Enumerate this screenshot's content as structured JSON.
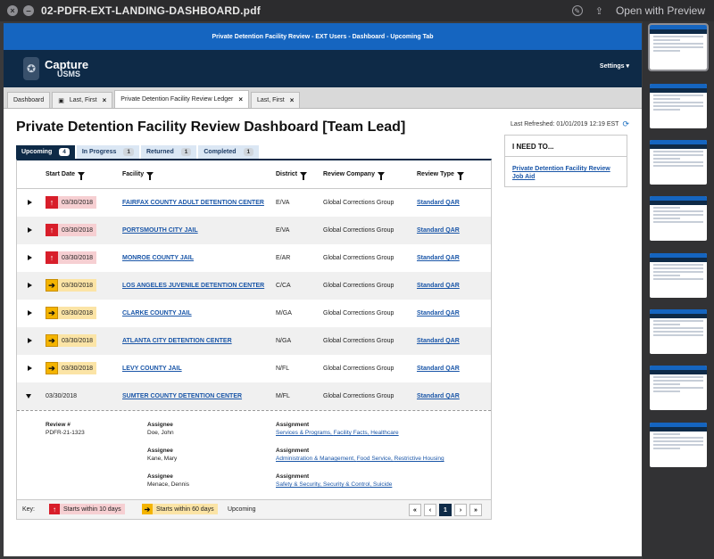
{
  "window": {
    "title": "02-PDFR-EXT-LANDING-DASHBOARD.pdf",
    "open_with": "Open with Preview"
  },
  "banner": "Private Detention Facility Review - EXT Users - Dashboard - Upcoming Tab",
  "header": {
    "logo_text": "Capture",
    "logo_sub": "USMS",
    "settings_label": "Settings ▾"
  },
  "page_tabs": [
    {
      "label": "Dashboard",
      "closable": false
    },
    {
      "label": "Last, First",
      "closable": true,
      "icon": "briefcase-icon"
    },
    {
      "label": "Private Detention Facility Review Ledger",
      "closable": true,
      "active": true
    },
    {
      "label": "Last, First",
      "closable": true
    }
  ],
  "main": {
    "title": "Private Detention Facility Review Dashboard [Team Lead]",
    "last_refreshed": "Last Refreshed: 01/01/2019 12:19 EST"
  },
  "status_tabs": [
    {
      "label": "Upcoming",
      "count": "4"
    },
    {
      "label": "In Progress",
      "count": "1"
    },
    {
      "label": "Returned",
      "count": "1"
    },
    {
      "label": "Completed",
      "count": "1"
    }
  ],
  "grid": {
    "columns": [
      "Start Date",
      "Facility",
      "District",
      "Review Company",
      "Review Type"
    ],
    "rows": [
      {
        "date": "03/30/2018",
        "urgency": "red",
        "facility": "FAIRFAX COUNTY ADULT DETENTION CENTER",
        "district": "E/VA",
        "company": "Global Corrections Group",
        "type": "Standard QAR"
      },
      {
        "date": "03/30/2018",
        "urgency": "red",
        "facility": "PORTSMOUTH CITY JAIL",
        "district": "E/VA",
        "company": "Global Corrections Group",
        "type": "Standard QAR"
      },
      {
        "date": "03/30/2018",
        "urgency": "red",
        "facility": "MONROE COUNTY JAIL",
        "district": "E/AR",
        "company": "Global Corrections Group",
        "type": "Standard QAR"
      },
      {
        "date": "03/30/2018",
        "urgency": "yellow",
        "facility": "LOS ANGELES JUVENILE DETENTION CENTER",
        "district": "C/CA",
        "company": "Global Corrections Group",
        "type": "Standard QAR"
      },
      {
        "date": "03/30/2018",
        "urgency": "yellow",
        "facility": "CLARKE COUNTY JAIL",
        "district": "M/GA",
        "company": "Global Corrections Group",
        "type": "Standard QAR"
      },
      {
        "date": "03/30/2018",
        "urgency": "yellow",
        "facility": "ATLANTA CITY DETENTION CENTER",
        "district": "N/GA",
        "company": "Global Corrections Group",
        "type": "Standard QAR"
      },
      {
        "date": "03/30/2018",
        "urgency": "yellow",
        "facility": "LEVY COUNTY JAIL",
        "district": "N/FL",
        "company": "Global Corrections Group",
        "type": "Standard QAR"
      },
      {
        "date": "03/30/2018",
        "urgency": "none",
        "facility": "SUMTER COUNTY DETENTION CENTER",
        "district": "M/FL",
        "company": "Global Corrections Group",
        "type": "Standard QAR"
      }
    ],
    "detail": {
      "review_label": "Review #",
      "review_value": "PDFR-21-1323",
      "assignee_label": "Assignee",
      "assignment_label": "Assignment",
      "assignees": [
        {
          "name": "Doe, John",
          "links": [
            "Services & Programs",
            "Facility Facts",
            "Healthcare"
          ]
        },
        {
          "name": "Kane, Mary",
          "links": [
            "Administration & Management",
            "Food Service",
            "Restrictive Housing"
          ]
        },
        {
          "name": "Menace, Dennis",
          "links": [
            "Safety & Security",
            "Security & Control",
            "Suicide"
          ]
        }
      ]
    },
    "footer": {
      "key_label": "Key:",
      "key_red": "Starts within 10 days",
      "key_yellow": "Starts within 60 days",
      "key_upcoming": "Upcoming",
      "current_page": "1"
    }
  },
  "sidebar": {
    "need_title": "I NEED TO...",
    "need_link": "Private Detention Facility Review Job Aid"
  },
  "colors": {
    "banner": "#1565c0",
    "header": "#0e2a47",
    "link": "#1a56a8",
    "urgent_red": "#d81e2a",
    "warn_yellow": "#f4b400"
  }
}
